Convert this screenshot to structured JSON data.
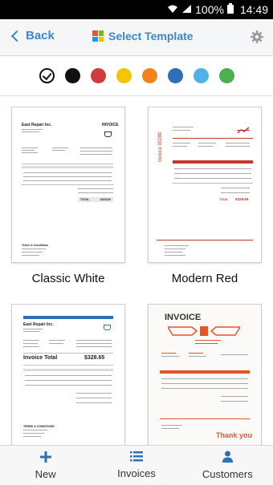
{
  "status_bar": {
    "battery": "100%",
    "time": "14:49"
  },
  "nav": {
    "back_label": "Back",
    "title": "Select Template"
  },
  "colors": {
    "accent": "#3d87c9",
    "swatches": [
      "outline",
      "#111111",
      "#d23b3b",
      "#f6c500",
      "#f5821f",
      "#2f6fb8",
      "#4fb3e6",
      "#4caf50"
    ]
  },
  "templates": [
    {
      "label": "Classic White",
      "doc": {
        "company": "East Repair Inc.",
        "heading": "INVOICE",
        "total": "TOTAL",
        "total_value": "$328.65",
        "terms": "Terms & Conditions"
      }
    },
    {
      "label": "Modern Red",
      "doc": {
        "invoice_tag": "Invoice 00280",
        "total_label": "TOTAL",
        "total_value": "$328.65"
      }
    },
    {
      "label": "",
      "doc": {
        "company": "East Repair Inc.",
        "invoice_total": "Invoice Total",
        "invoice_total_value": "$328.65",
        "terms": "TERMS & CONDITIONS"
      }
    },
    {
      "label": "",
      "doc": {
        "heading": "INVOICE",
        "thanks": "Thank you"
      }
    }
  ],
  "tabs": [
    {
      "label": "New"
    },
    {
      "label": "Invoices"
    },
    {
      "label": "Customers"
    }
  ]
}
